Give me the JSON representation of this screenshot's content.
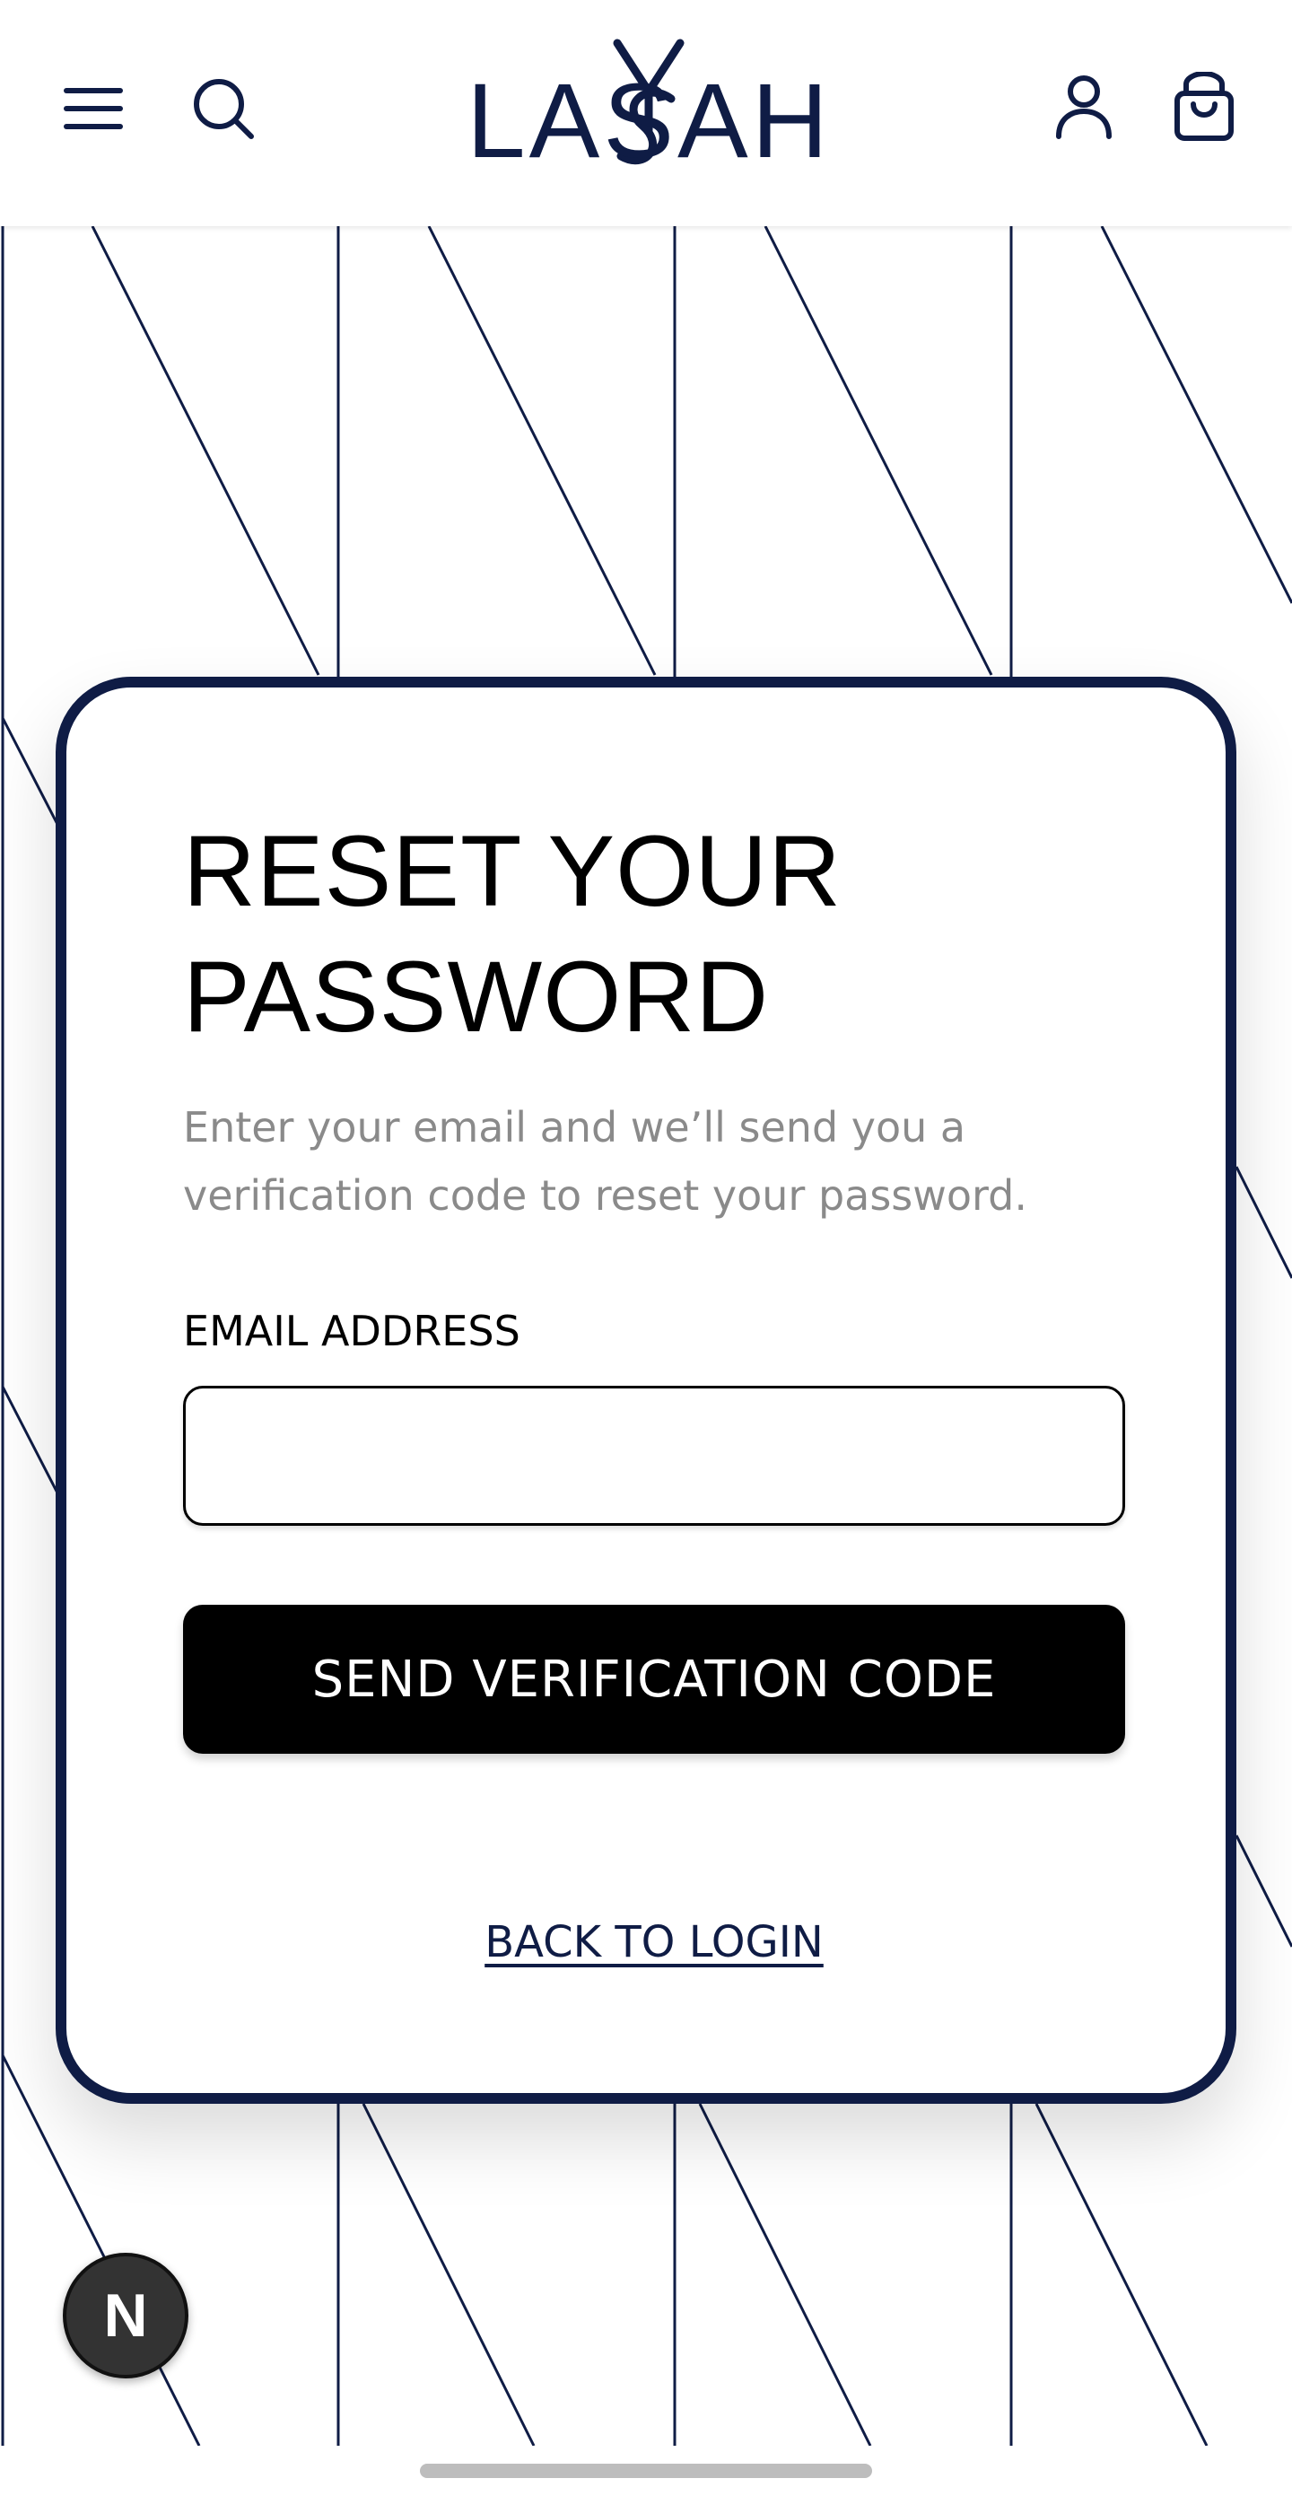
{
  "header": {
    "brand": "LASAH",
    "menu_icon": "hamburger-menu-icon",
    "search_icon": "search-icon",
    "account_icon": "user-icon",
    "cart_icon": "shopping-bag-icon"
  },
  "form": {
    "title": "RESET YOUR PASSWORD",
    "subtitle": "Enter your email and we’ll send you a verification code to reset your password.",
    "email_label": "EMAIL ADDRESS",
    "email_value": "",
    "submit_label": "SEND VERIFICATION CODE",
    "back_label": "BACK TO LOGIN"
  },
  "fab": {
    "label": "N"
  },
  "colors": {
    "navy": "#0f1c45",
    "black": "#000000",
    "subtitle_gray": "#8a8a8a",
    "background": "#ffffff"
  }
}
